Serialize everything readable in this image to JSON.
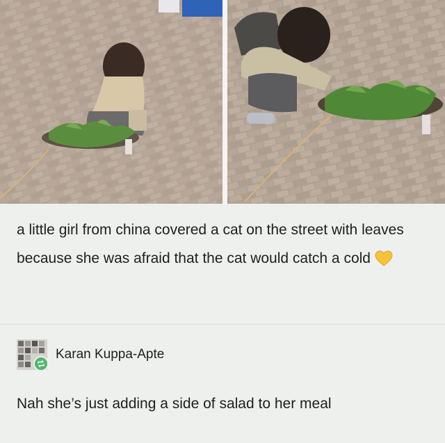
{
  "post": {
    "text": "a little girl from china covered a cat on the street with leaves because she was afraid that the cat would catch a cold",
    "emoji": "yellow-heart"
  },
  "reply": {
    "username": "Karan Kuppa-Apte",
    "text": "Nah she’s just adding a side of salad to her meal"
  },
  "icons": {
    "reblog": "reblog-icon",
    "heart": "yellow-heart-icon"
  },
  "colors": {
    "background": "#eef0ee",
    "text": "#1e1e1e",
    "reblog_badge": "#4fb66b",
    "heart": "#f5c33b"
  }
}
